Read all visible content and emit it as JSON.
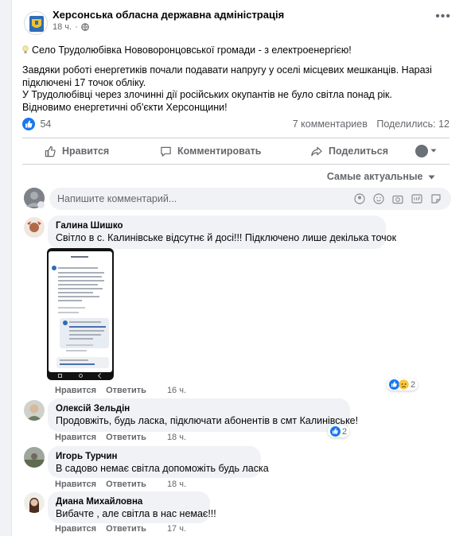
{
  "post": {
    "page_name": "Херсонська обласна державна адміністрація",
    "time": "18 ч.",
    "paragraphs": [
      "Село Трудолюбівка Нововоронцовської громади - з електроенергією!",
      "Завдяки роботі енергетиків почали подавати напругу у оселі місцевих мешканців. Наразі підключені 17 точок обліку.",
      "У Трудолюбівці через злочинні дії російських окупантів не було світла понад рік. Відновимо енергетичні об'єкти Херсонщини!"
    ],
    "reaction_count": "54",
    "comments_count": "7 комментариев",
    "shares_count": "Поделились: 12"
  },
  "actions": {
    "like": "Нравится",
    "comment": "Комментировать",
    "share": "Поделиться"
  },
  "sort_label": "Самые актуальные",
  "comment_placeholder": "Напишите комментарий...",
  "comments": [
    {
      "author": "Галина Шишко",
      "text": "Світло в с. Калинівське відсутнє й досі!!! Підключено лише декілька точок",
      "like": "Нравится",
      "reply": "Ответить",
      "time": "16 ч.",
      "reactions": "2"
    },
    {
      "author": "Олексій Зельдін",
      "text": "Продовжіть, будь ласка, підключати абонентів в смт Калинівське!",
      "like": "Нравится",
      "reply": "Ответить",
      "time": "18 ч.",
      "reactions": "2"
    },
    {
      "author": "Игорь Турчин",
      "text": "В садово немає світла допоможіть будь ласка",
      "like": "Нравится",
      "reply": "Ответить",
      "time": "18 ч."
    },
    {
      "author": "Диана Михайловна",
      "text": "Вибачте , але світла в нас немає!!!",
      "like": "Нравится",
      "reply": "Ответить",
      "time": "17 ч."
    }
  ],
  "colors": {
    "accent": "#1877f2",
    "text_secondary": "#65676b",
    "bubble": "#f0f2f5"
  }
}
